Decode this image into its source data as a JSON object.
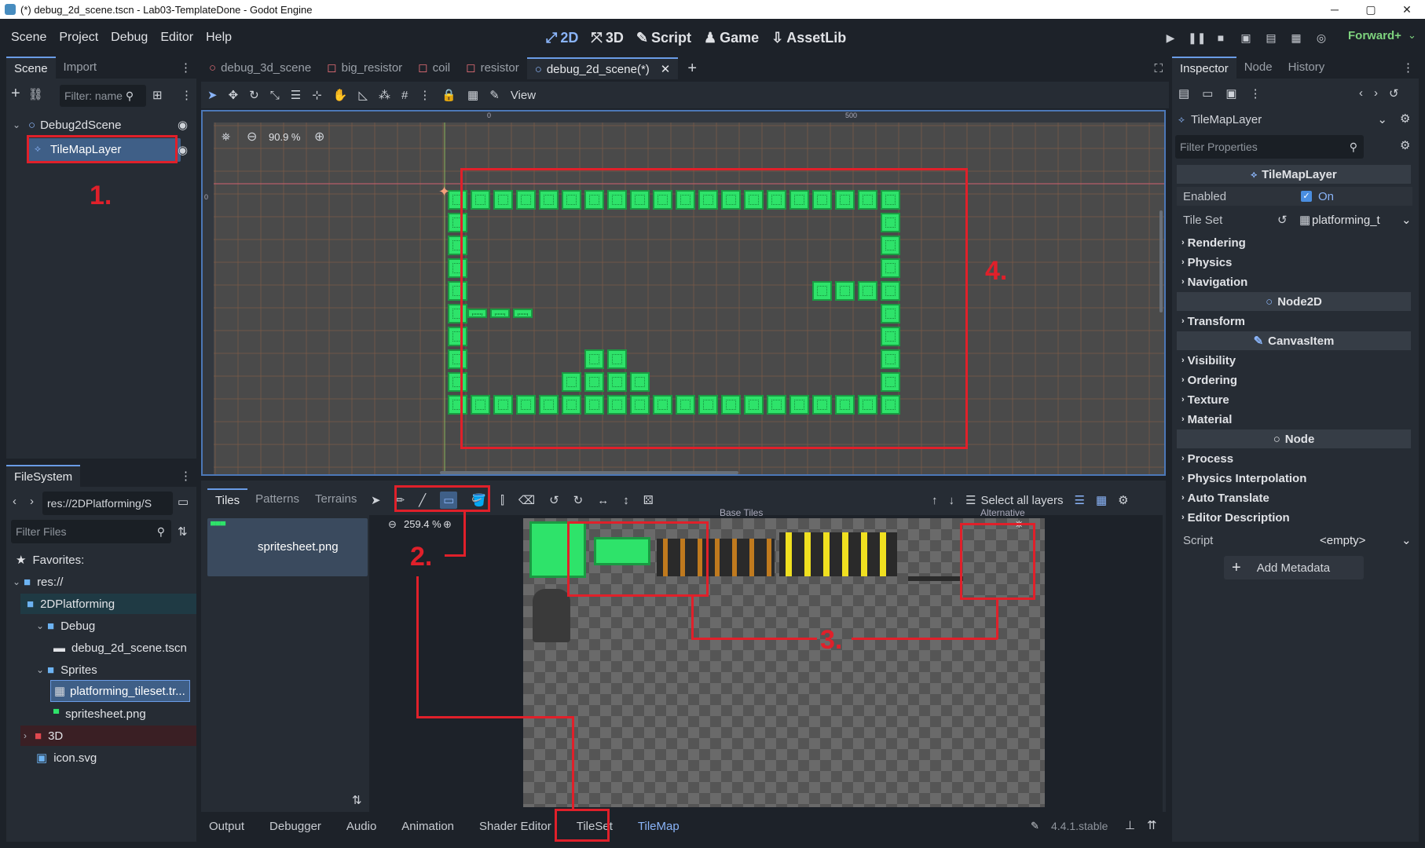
{
  "window": {
    "title": "(*) debug_2d_scene.tscn - Lab03-TemplateDone - Godot Engine",
    "min": "─",
    "max": "▢",
    "close": "✕"
  },
  "menu": [
    "Scene",
    "Project",
    "Debug",
    "Editor",
    "Help"
  ],
  "workspaces": [
    {
      "label": "2D",
      "icon": "2d-icon"
    },
    {
      "label": "3D",
      "icon": "3d-icon"
    },
    {
      "label": "Script",
      "icon": "script-icon"
    },
    {
      "label": "Game",
      "icon": "game-icon"
    },
    {
      "label": "AssetLib",
      "icon": "assetlib-icon"
    }
  ],
  "renderer": "Forward+",
  "scene_dock": {
    "tabs": [
      "Scene",
      "Import"
    ],
    "filter_placeholder": "Filter: name",
    "root": "Debug2dScene",
    "child": "TileMapLayer"
  },
  "filesystem": {
    "tab": "FileSystem",
    "path": "res://2DPlatforming/S",
    "filter_placeholder": "Filter Files",
    "items": {
      "favorites": "Favorites:",
      "res": "res://",
      "platforming": "2DPlatforming",
      "debug": "Debug",
      "debug_scene": "debug_2d_scene.tscn",
      "sprites": "Sprites",
      "tileset": "platforming_tileset.tr...",
      "spritesheet": "spritesheet.png",
      "three_d": "3D",
      "icon": "icon.svg"
    }
  },
  "editor_tabs": [
    "debug_3d_scene",
    "big_resistor",
    "coil",
    "resistor",
    "debug_2d_scene(*)"
  ],
  "toolbar": {
    "view": "View"
  },
  "viewport": {
    "zoom": "90.9 %",
    "ruler_0": "0",
    "ruler_500": "500",
    "ruler_left_0": "0"
  },
  "tilemap_panel": {
    "tabs": [
      "Tiles",
      "Patterns",
      "Terrains"
    ],
    "select_all_layers": "Select all layers",
    "source": "spritesheet.png",
    "atlas_zoom": "259.4 %",
    "base_tiles": "Base Tiles",
    "alternative": "Alternative"
  },
  "bottom_tabs": [
    "Output",
    "Debugger",
    "Audio",
    "Animation",
    "Shader Editor",
    "TileSet",
    "TileMap"
  ],
  "version": "4.4.1.stable",
  "inspector": {
    "tabs": [
      "Inspector",
      "Node",
      "History"
    ],
    "node": "TileMapLayer",
    "filter_placeholder": "Filter Properties",
    "section_tilemap": "TileMapLayer",
    "enabled_label": "Enabled",
    "enabled_value": "On",
    "tileset_label": "Tile Set",
    "tileset_value": "platforming_t",
    "groups1": [
      "Rendering",
      "Physics",
      "Navigation"
    ],
    "section_node2d": "Node2D",
    "groups2": [
      "Transform"
    ],
    "section_canvas": "CanvasItem",
    "groups3": [
      "Visibility",
      "Ordering",
      "Texture",
      "Material"
    ],
    "section_node": "Node",
    "groups4": [
      "Process",
      "Physics Interpolation",
      "Auto Translate",
      "Editor Description"
    ],
    "script_label": "Script",
    "script_value": "<empty>",
    "add_metadata": "Add Metadata"
  },
  "annotations": [
    "1.",
    "2.",
    "3.",
    "4."
  ],
  "colors": {
    "accent": "#6a9ce6",
    "annotation": "#e0202a",
    "tile_green": "#2ee36a",
    "render_green": "#7ed37e"
  }
}
